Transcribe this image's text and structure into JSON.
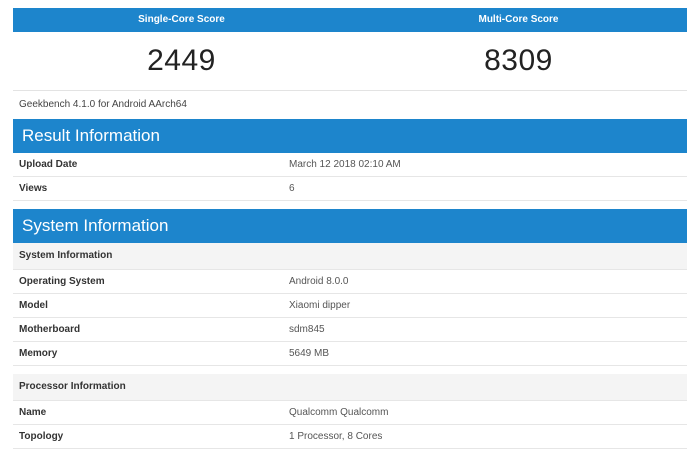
{
  "scores": {
    "single_label": "Single-Core Score",
    "multi_label": "Multi-Core Score",
    "single_value": "2449",
    "multi_value": "8309"
  },
  "version_text": "Geekbench 4.1.0 for Android AArch64",
  "result_info": {
    "title": "Result Information",
    "rows": [
      {
        "key": "Upload Date",
        "value": "March 12 2018 02:10 AM"
      },
      {
        "key": "Views",
        "value": "6"
      }
    ]
  },
  "system_info": {
    "title": "System Information",
    "system_subhead": "System Information",
    "system_rows": [
      {
        "key": "Operating System",
        "value": "Android 8.0.0"
      },
      {
        "key": "Model",
        "value": "Xiaomi dipper"
      },
      {
        "key": "Motherboard",
        "value": "sdm845"
      },
      {
        "key": "Memory",
        "value": "5649 MB"
      }
    ],
    "processor_subhead": "Processor Information",
    "processor_rows": [
      {
        "key": "Name",
        "value": "Qualcomm Qualcomm"
      },
      {
        "key": "Topology",
        "value": "1 Processor, 8 Cores"
      }
    ]
  },
  "colors": {
    "header_blue": "#1d85cc"
  }
}
